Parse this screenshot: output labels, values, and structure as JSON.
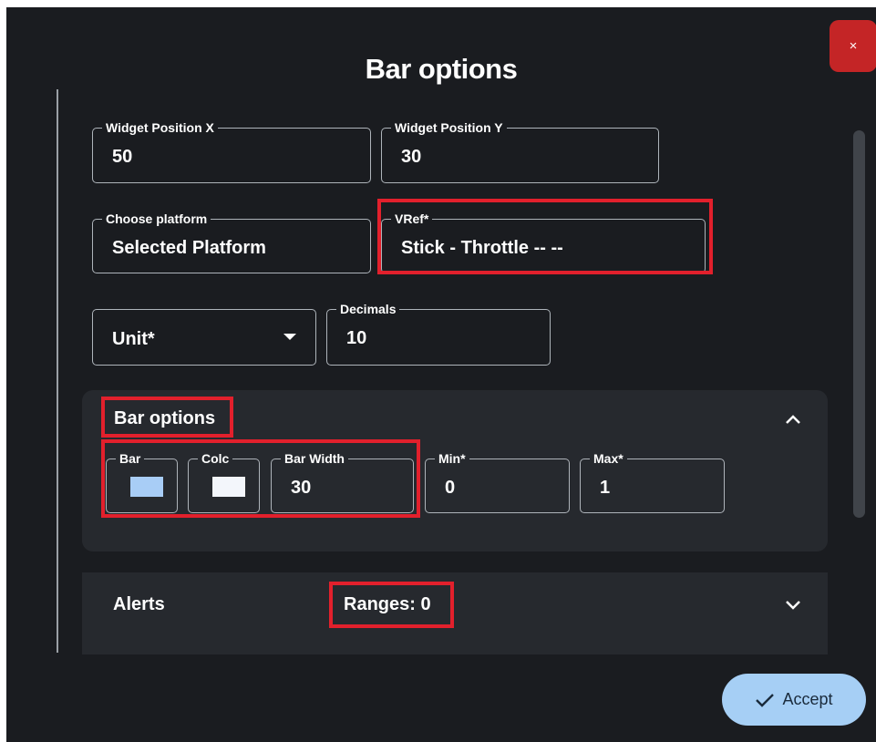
{
  "dialog": {
    "title": "Bar options",
    "close_label": "×",
    "accept_label": "Accept"
  },
  "fields": {
    "pos_x": {
      "label": "Widget Position X",
      "value": "50"
    },
    "pos_y": {
      "label": "Widget Position Y",
      "value": "30"
    },
    "platform": {
      "label": "Choose platform",
      "value": "Selected Platform"
    },
    "vref": {
      "label": "VRef*",
      "value": "Stick - Throttle -- --"
    },
    "unit": {
      "placeholder": "Unit*"
    },
    "decimals": {
      "label": "Decimals",
      "value": "10"
    }
  },
  "bar_section": {
    "title": "Bar options",
    "bar_color": {
      "label": "Bar",
      "color": "#a8cdf6"
    },
    "color2": {
      "label": "Colc",
      "color": "#f3f6fb"
    },
    "bar_width": {
      "label": "Bar Width",
      "value": "30"
    },
    "min": {
      "label": "Min*",
      "value": "0"
    },
    "max": {
      "label": "Max*",
      "value": "1"
    }
  },
  "alerts_section": {
    "title": "Alerts",
    "ranges": "Ranges: 0"
  },
  "colors": {
    "background": "#1a1c20",
    "panel": "#26292e",
    "accent": "#a6cff5",
    "close": "#c42526",
    "highlight": "#e2202c"
  },
  "icons": {
    "close": "close-icon",
    "dropdown": "caret-down-icon",
    "collapse": "chevron-up-icon",
    "expand": "chevron-down-icon",
    "accept": "check-icon"
  }
}
